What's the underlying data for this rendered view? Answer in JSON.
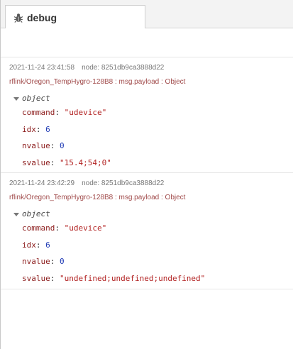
{
  "tab": {
    "label": "debug",
    "icon": "bug-icon"
  },
  "messages": [
    {
      "timestamp": "2021-11-24 23:41:58",
      "node": "node: 8251db9ca3888d22",
      "topic": "rflink/Oregon_TempHygro-128B8 : msg.payload : Object",
      "type_label": "object",
      "props": [
        {
          "key": "command",
          "sep": ": ",
          "value": "\"udevice\"",
          "kind": "string"
        },
        {
          "key": "idx",
          "sep": ": ",
          "value": "6",
          "kind": "number"
        },
        {
          "key": "nvalue",
          "sep": ": ",
          "value": "0",
          "kind": "number"
        },
        {
          "key": "svalue",
          "sep": ": ",
          "value": "\"15.4;54;0\"",
          "kind": "string"
        }
      ]
    },
    {
      "timestamp": "2021-11-24 23:42:29",
      "node": "node: 8251db9ca3888d22",
      "topic": "rflink/Oregon_TempHygro-128B8 : msg.payload : Object",
      "type_label": "object",
      "props": [
        {
          "key": "command",
          "sep": ": ",
          "value": "\"udevice\"",
          "kind": "string"
        },
        {
          "key": "idx",
          "sep": ": ",
          "value": "6",
          "kind": "number"
        },
        {
          "key": "nvalue",
          "sep": ": ",
          "value": "0",
          "kind": "number"
        },
        {
          "key": "svalue",
          "sep": ": ",
          "value": "\"undefined;undefined;undefined\"",
          "kind": "string"
        }
      ]
    }
  ],
  "colors": {
    "key": "#8b1a1a",
    "string": "#b22222",
    "number": "#1f3ab5",
    "topic": "#a04a4a"
  }
}
